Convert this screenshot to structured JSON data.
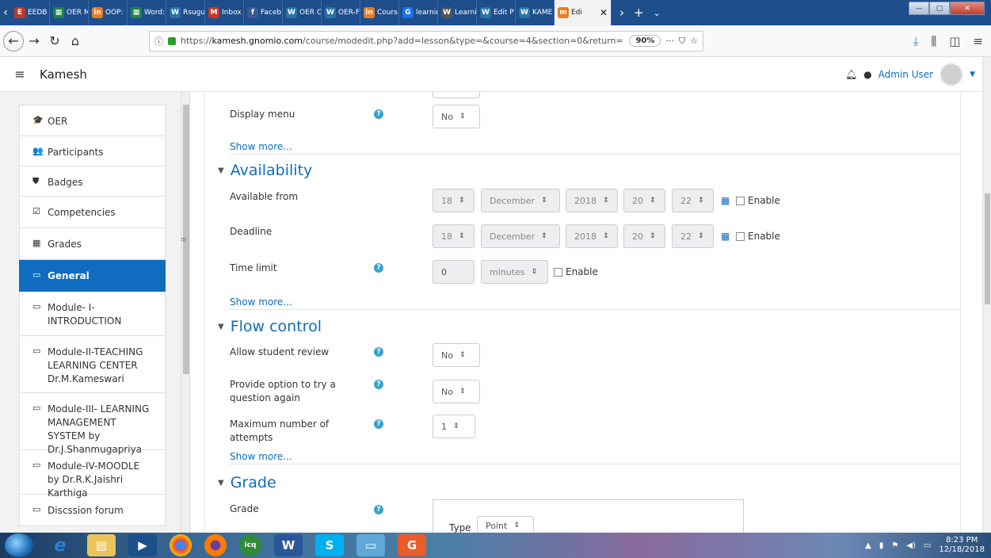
{
  "browser": {
    "tabs": [
      {
        "label": "EEDB",
        "color": "#c0392b",
        "glyph": "E"
      },
      {
        "label": "OER M",
        "color": "#1e8449",
        "glyph": "▦"
      },
      {
        "label": "OOP:",
        "color": "#e67e22",
        "glyph": "in"
      },
      {
        "label": "Word:",
        "color": "#1e8449",
        "glyph": "▦"
      },
      {
        "label": "Rsugu",
        "color": "#2874a6",
        "glyph": "W"
      },
      {
        "label": "Inbox",
        "color": "#c0392b",
        "glyph": "M"
      },
      {
        "label": "Faceb",
        "color": "#3b5998",
        "glyph": "f"
      },
      {
        "label": "OER C",
        "color": "#2874a6",
        "glyph": "W"
      },
      {
        "label": "OER-F",
        "color": "#2874a6",
        "glyph": "W"
      },
      {
        "label": "Cours",
        "color": "#e67e22",
        "glyph": "in"
      },
      {
        "label": "learnin",
        "color": "#1a73e8",
        "glyph": "G"
      },
      {
        "label": "Learni",
        "color": "#555555",
        "glyph": "W"
      },
      {
        "label": "Edit P",
        "color": "#2874a6",
        "glyph": "W"
      },
      {
        "label": "KAME",
        "color": "#2874a6",
        "glyph": "W"
      }
    ],
    "active_tab": {
      "label": "Edi",
      "glyph": "m"
    },
    "url_host": "kamesh.gnomio.com",
    "url_prefix": "https://",
    "url_path": "/course/modedit.php?add=lesson&type=&course=4&section=0&return=",
    "zoom": "90%"
  },
  "header": {
    "site_name": "Kamesh",
    "user_name": "Admin User"
  },
  "drawer": {
    "items": [
      {
        "label": "OER",
        "icon": "graduation-cap-icon",
        "glyph": "🎓"
      },
      {
        "label": "Participants",
        "icon": "users-icon",
        "glyph": "👥"
      },
      {
        "label": "Badges",
        "icon": "shield-icon",
        "glyph": "⛊"
      },
      {
        "label": "Competencies",
        "icon": "checkbox-icon",
        "glyph": "☑"
      },
      {
        "label": "Grades",
        "icon": "table-icon",
        "glyph": "▦"
      },
      {
        "label": "General",
        "icon": "folder-icon",
        "glyph": "▭",
        "active": true
      },
      {
        "label": "Module- I-INTRODUCTION",
        "icon": "folder-icon",
        "glyph": "▭"
      },
      {
        "label": "Module-II-TEACHING LEARNING CENTER Dr.M.Kameswari",
        "icon": "folder-icon",
        "glyph": "▭"
      },
      {
        "label": "Module-III- LEARNING MANAGEMENT SYSTEM by Dr.J.Shanmugapriya",
        "icon": "folder-icon",
        "glyph": "▭"
      },
      {
        "label": "Module-IV-MOODLE by Dr.R.K.Jaishri Karthiga",
        "icon": "folder-icon",
        "glyph": "▭"
      },
      {
        "label": "Discssion forum",
        "icon": "folder-icon",
        "glyph": "▭"
      }
    ]
  },
  "form": {
    "display_menu": {
      "label": "Display menu",
      "value": "No"
    },
    "show_more": "Show more...",
    "availability": {
      "heading": "Availability",
      "available_from": {
        "label": "Available from",
        "day": "18",
        "month": "December",
        "year": "2018",
        "hour": "20",
        "minute": "22",
        "enable": "Enable"
      },
      "deadline": {
        "label": "Deadline",
        "day": "18",
        "month": "December",
        "year": "2018",
        "hour": "20",
        "minute": "22",
        "enable": "Enable"
      },
      "time_limit": {
        "label": "Time limit",
        "value": "0",
        "unit": "minutes",
        "enable": "Enable"
      }
    },
    "flow_control": {
      "heading": "Flow control",
      "allow_review": {
        "label": "Allow student review",
        "value": "No"
      },
      "try_again": {
        "label": "Provide option to try a question again",
        "value": "No"
      },
      "max_attempts": {
        "label": "Maximum number of attempts",
        "value": "1"
      }
    },
    "grade": {
      "heading": "Grade",
      "label": "Grade",
      "type_label": "Type",
      "type_value": "Point"
    }
  },
  "taskbar": {
    "time": "8:23 PM",
    "date": "12/18/2018"
  }
}
